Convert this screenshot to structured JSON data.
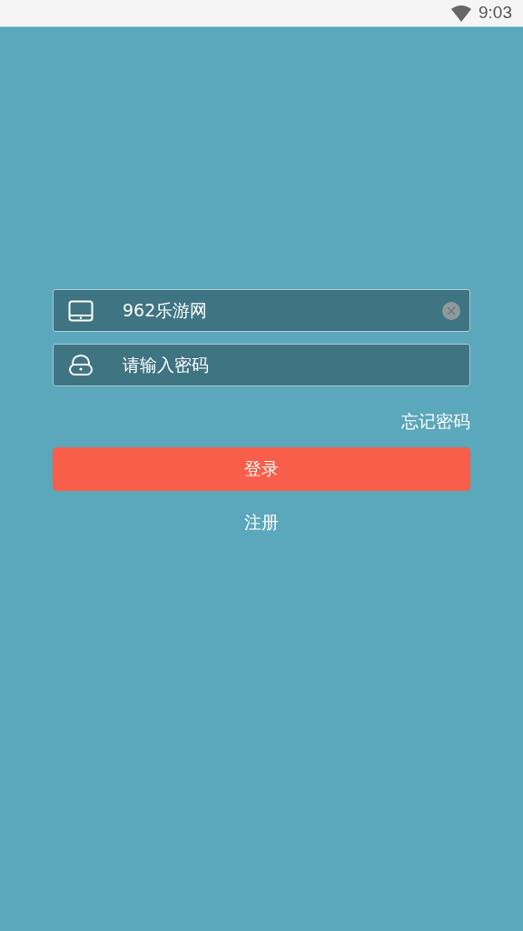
{
  "status_bar": {
    "time": "9:03"
  },
  "username": {
    "value": "962乐游网"
  },
  "password": {
    "placeholder": "请输入密码"
  },
  "forgot_link": "忘记密码",
  "login_button": "登录",
  "register_link": "注册"
}
